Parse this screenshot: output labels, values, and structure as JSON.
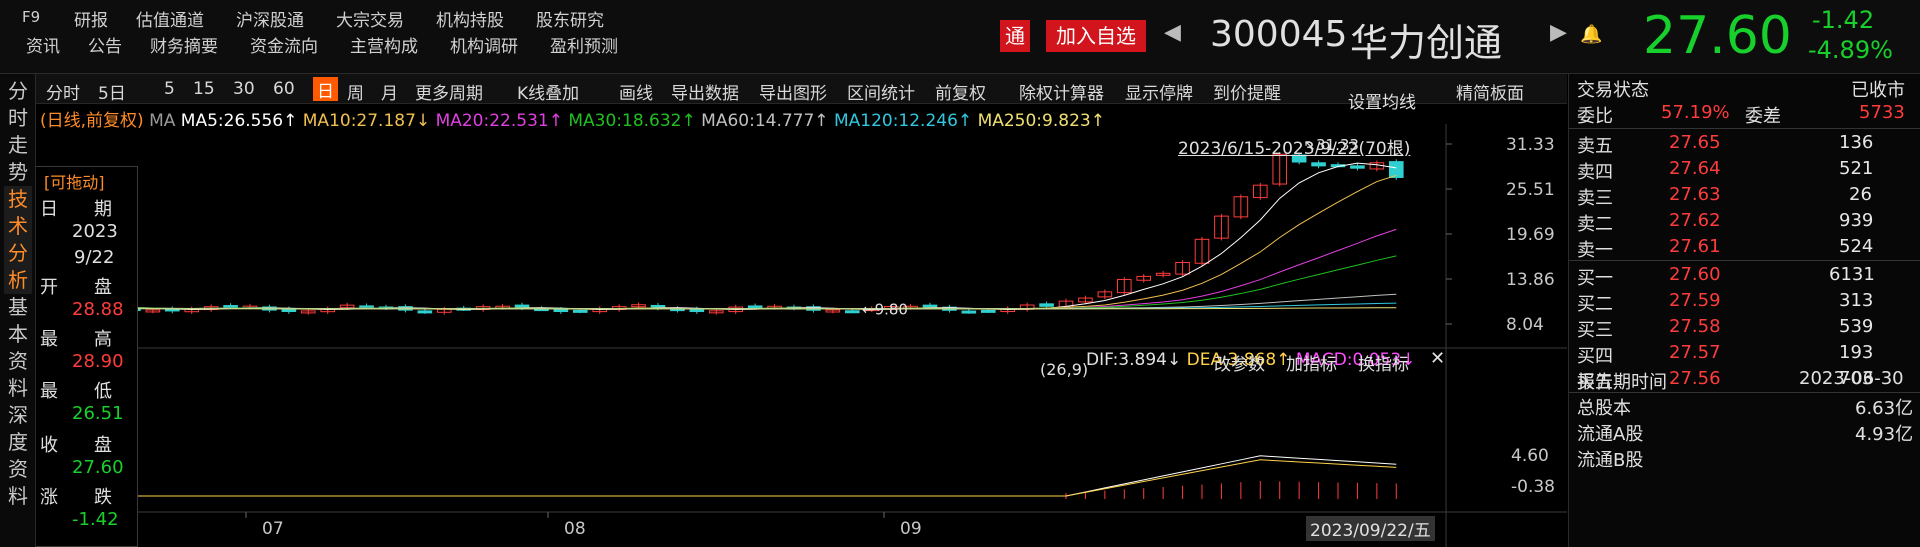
{
  "top": {
    "f9": "F9",
    "nav_row1": [
      "研报",
      "估值通道",
      "沪深股通",
      "大宗交易",
      "机构持股",
      "股东研究"
    ],
    "nav_row2": [
      "资讯",
      "公告",
      "财务摘要",
      "资金流向",
      "主营构成",
      "机构调研",
      "盈利预测"
    ],
    "tong": "通",
    "add_fav": "加入自选",
    "code": "300045",
    "name": "华力创通",
    "price": "27.60",
    "change": "-1.42",
    "change_pct": "-4.89%"
  },
  "left_tabs": [
    "分时走势",
    "技术分析",
    "基本资料",
    "深度资料"
  ],
  "toolbar": {
    "items": [
      "分时",
      "5日",
      "5",
      "15",
      "30",
      "60",
      "日",
      "周",
      "月",
      "更多周期",
      "K线叠加",
      "画线",
      "导出数据",
      "导出图形",
      "区间统计",
      "前复权",
      "除权计算器",
      "显示停牌",
      "到价提醒"
    ],
    "active": "日",
    "right": "精简板面"
  },
  "ma_line": {
    "prefix": "(日线,前复权)",
    "ma": "MA",
    "ma5": "MA5:26.556↑",
    "ma10": "MA10:27.187↓",
    "ma20": "MA20:22.531↑",
    "ma30": "MA30:18.632↑",
    "ma60": "MA60:14.777↑",
    "ma120": "MA120:12.246↑",
    "ma250": "MA250:9.823↑"
  },
  "chart": {
    "settings": "设置均线",
    "range": "2023/6/15-2023/9/22(70根)",
    "y_ticks": [
      "31.33",
      "25.51",
      "19.69",
      "13.86",
      "8.04"
    ],
    "high_label": "31.33",
    "low_label": "9.80",
    "x_ticks": [
      "07",
      "08",
      "09"
    ],
    "cursor_date": "2023/09/22/五"
  },
  "macd": {
    "params": "(26,9)",
    "dif": "DIF:3.894↓",
    "dea": "DEA:3.868↑",
    "macd": "MACD:0.053↓",
    "btn1": "改参数",
    "btn2": "加指标",
    "btn3": "换指标",
    "y_ticks": [
      "4.60",
      "-0.38"
    ]
  },
  "infobox": {
    "title": "[可拖动]",
    "date_label": "日　　期",
    "year": "2023",
    "md": "9/22",
    "open_label": "开　　盘",
    "open": "28.88",
    "high_label": "最　　高",
    "high": "28.90",
    "low_label": "最　　低",
    "low": "26.51",
    "close_label": "收　　盘",
    "close": "27.60",
    "chg_label": "涨　　跌",
    "chg": "-1.42"
  },
  "right": {
    "status_label": "交易状态",
    "status": "已收市",
    "wb_label": "委比",
    "wb": "57.19%",
    "wc_label": "委差",
    "wc": "5733",
    "asks": [
      {
        "l": "卖五",
        "p": "27.65",
        "v": "136"
      },
      {
        "l": "卖四",
        "p": "27.64",
        "v": "521"
      },
      {
        "l": "卖三",
        "p": "27.63",
        "v": "26"
      },
      {
        "l": "卖二",
        "p": "27.62",
        "v": "939"
      },
      {
        "l": "卖一",
        "p": "27.61",
        "v": "524"
      }
    ],
    "bids": [
      {
        "l": "买一",
        "p": "27.60",
        "v": "6131"
      },
      {
        "l": "买二",
        "p": "27.59",
        "v": "313"
      },
      {
        "l": "买三",
        "p": "27.58",
        "v": "539"
      },
      {
        "l": "买四",
        "p": "27.57",
        "v": "193"
      },
      {
        "l": "买五",
        "p": "27.56",
        "v": "703"
      }
    ],
    "report_label": "报告期时间",
    "report": "2023-06-30",
    "total_label": "总股本",
    "total": "6.63亿",
    "float_label": "流通A股",
    "float": "4.93亿",
    "more_label": "流通B股"
  },
  "colors": {
    "up": "#ff3c3c",
    "down": "#18d02c",
    "ma5": "#ffffff",
    "ma10": "#f0c050",
    "ma20": "#e040e0",
    "ma30": "#20c020",
    "ma60": "#c0c0c0",
    "ma120": "#30c8e0",
    "ma250": "#f0e070"
  }
}
